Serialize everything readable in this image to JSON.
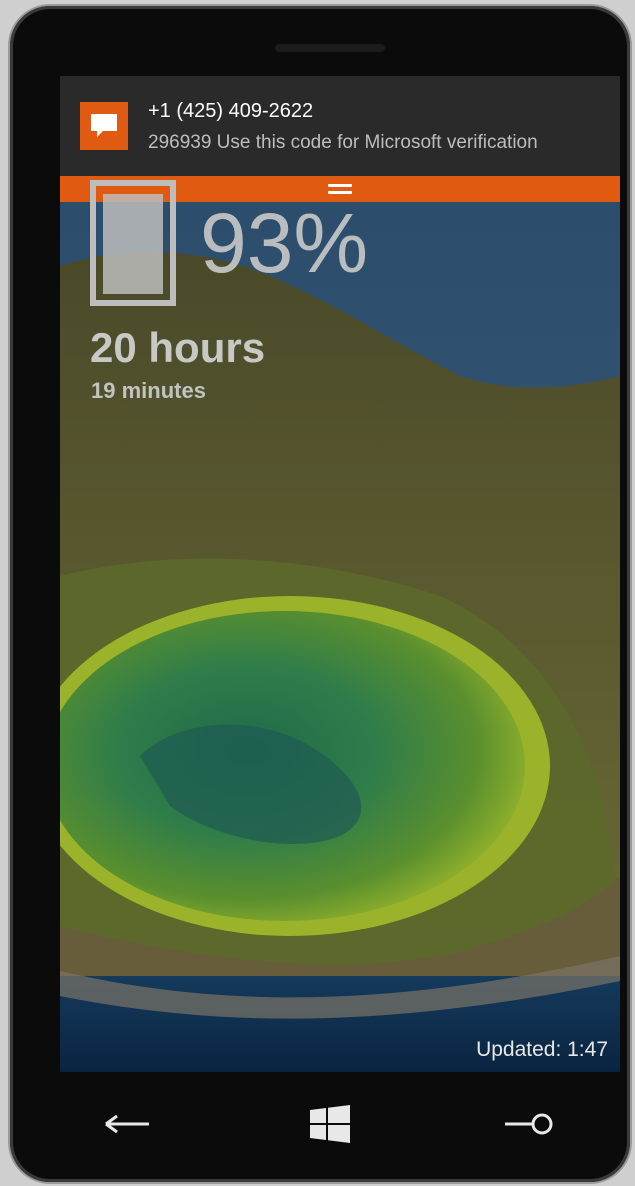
{
  "notification": {
    "sender": "+1 (425) 409-2622",
    "message": "296939 Use this code for Microsoft verification",
    "icon": "message-icon",
    "accent": "#e05a12"
  },
  "lockscreen": {
    "battery_percent": "93%",
    "battery_level": 0.93,
    "time_remaining_hours": "20 hours",
    "time_remaining_minutes": "19 minutes",
    "updated": "Updated: 1:47"
  },
  "nav": {
    "back_icon": "back-arrow-icon",
    "start_icon": "windows-logo-icon",
    "search_icon": "search-icon"
  }
}
